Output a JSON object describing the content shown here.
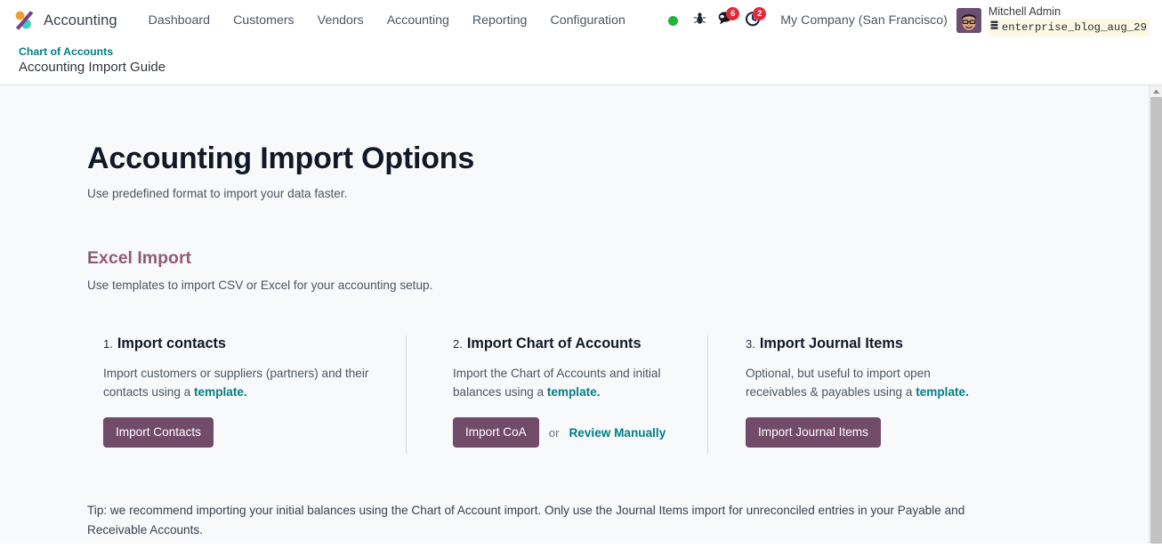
{
  "navbar": {
    "logo_icon": "odoo-accounting-logo-icon",
    "brand": "Accounting",
    "menu": [
      {
        "label": "Dashboard"
      },
      {
        "label": "Customers"
      },
      {
        "label": "Vendors"
      },
      {
        "label": "Accounting"
      },
      {
        "label": "Reporting"
      },
      {
        "label": "Configuration"
      }
    ],
    "status_dot_color": "#1eb53a",
    "status_icon": "online-status-dot-icon",
    "debug_icon": "bug-icon",
    "messages_icon": "chat-bubble-icon",
    "messages_count": "6",
    "activities_icon": "clock-activity-icon",
    "activities_count": "2",
    "badge_color": "#e02a3c",
    "company": "My Company (San Francisco)",
    "avatar_icon": "user-avatar",
    "user_name": "Mitchell Admin",
    "database_icon": "database-icon",
    "database_name": "enterprise_blog_aug_29"
  },
  "breadcrumb": {
    "parent": "Chart of Accounts",
    "current": "Accounting Import Guide",
    "link_color": "#017e84"
  },
  "page": {
    "title": "Accounting Import Options",
    "subtitle": "Use predefined format to import your data faster.",
    "section_title": "Excel Import",
    "section_title_color": "#8f5c78",
    "section_subtitle": "Use templates to import CSV or Excel for your accounting setup.",
    "tip": "Tip: we recommend importing your initial balances using the Chart of Account import. Only use the Journal Items import for unreconciled entries in your Payable and Receivable Accounts."
  },
  "columns": [
    {
      "number": "1.",
      "title": "Import contacts",
      "desc_before": "Import customers or suppliers (partners) and their contacts using a ",
      "desc_link": "template.",
      "desc_after": "",
      "button": "Import Contacts",
      "or": "",
      "secondary_link": ""
    },
    {
      "number": "2.",
      "title": "Import Chart of Accounts",
      "desc_before": "Import the Chart of Accounts and initial balances using a ",
      "desc_link": "template.",
      "desc_after": "",
      "button": "Import CoA",
      "or": "or",
      "secondary_link": "Review Manually"
    },
    {
      "number": "3.",
      "title": "Import Journal Items",
      "desc_before": "Optional, but useful to import open receivables & payables using a ",
      "desc_link": "template.",
      "desc_after": "",
      "button": "Import Journal Items",
      "or": "",
      "secondary_link": ""
    }
  ],
  "theme": {
    "button_color": "#714b67",
    "link_color": "#017e84",
    "content_bg": "#f8f9fa"
  },
  "scrollbar": {
    "up_arrow_icon": "scroll-up-arrow-icon",
    "thumb_icon": "scrollbar-thumb"
  }
}
